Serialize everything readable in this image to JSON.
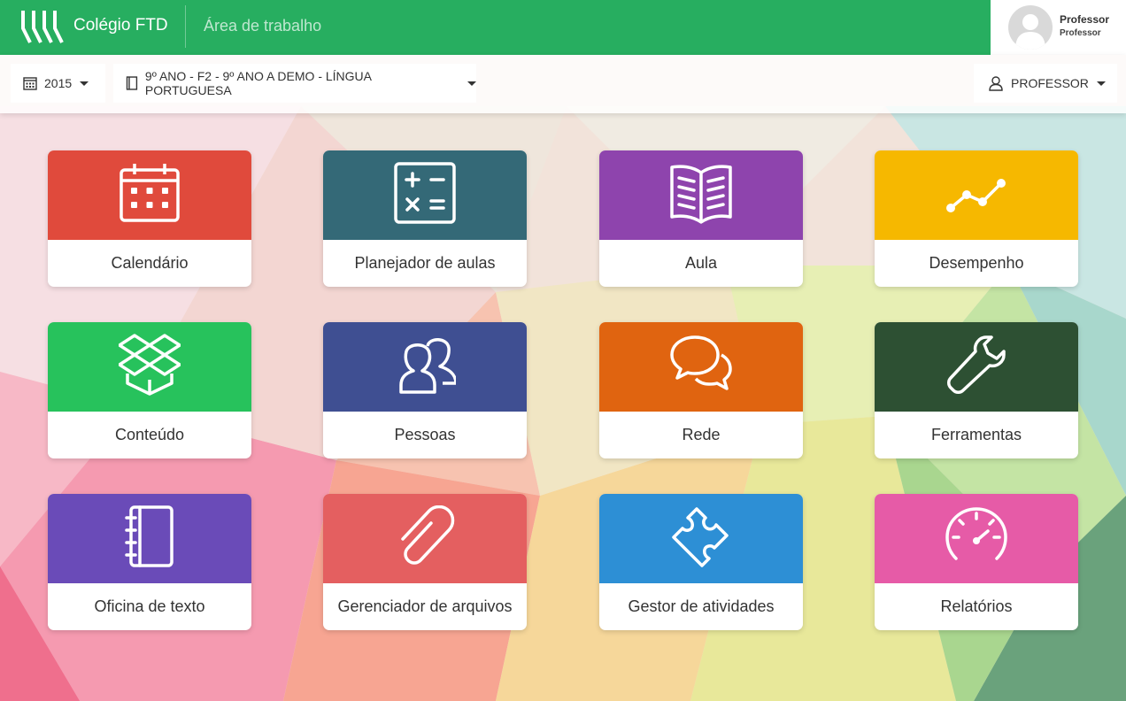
{
  "header": {
    "brand": "Colégio FTD",
    "section": "Área de trabalho",
    "user_name": "Professor",
    "user_role": "Professor"
  },
  "toolbar": {
    "year": "2015",
    "class": "9º ANO - F2 - 9º ANO A DEMO - LÍNGUA PORTUGUESA",
    "role": "PROFESSOR"
  },
  "colors": {
    "header_green": "#27ae60"
  },
  "tiles": [
    {
      "label": "Calendário",
      "icon": "calendar-icon",
      "color": "#e04a3c"
    },
    {
      "label": "Planejador de aulas",
      "icon": "calculator-icon",
      "color": "#346977"
    },
    {
      "label": "Aula",
      "icon": "open-book-icon",
      "color": "#8e44ad"
    },
    {
      "label": "Desempenho",
      "icon": "line-chart-icon",
      "color": "#f6b800"
    },
    {
      "label": "Conteúdo",
      "icon": "dropbox-icon",
      "color": "#27c25c"
    },
    {
      "label": "Pessoas",
      "icon": "people-icon",
      "color": "#3f4f92"
    },
    {
      "label": "Rede",
      "icon": "chat-bubbles-icon",
      "color": "#e06410"
    },
    {
      "label": "Ferramentas",
      "icon": "wrench-icon",
      "color": "#2d5033"
    },
    {
      "label": "Oficina de texto",
      "icon": "notebook-icon",
      "color": "#6a4bb8"
    },
    {
      "label": "Gerenciador de arquivos",
      "icon": "paperclip-icon",
      "color": "#e45f60"
    },
    {
      "label": "Gestor de atividades",
      "icon": "puzzle-icon",
      "color": "#2d8fd5"
    },
    {
      "label": "Relatórios",
      "icon": "speedometer-icon",
      "color": "#e65ba7"
    }
  ]
}
